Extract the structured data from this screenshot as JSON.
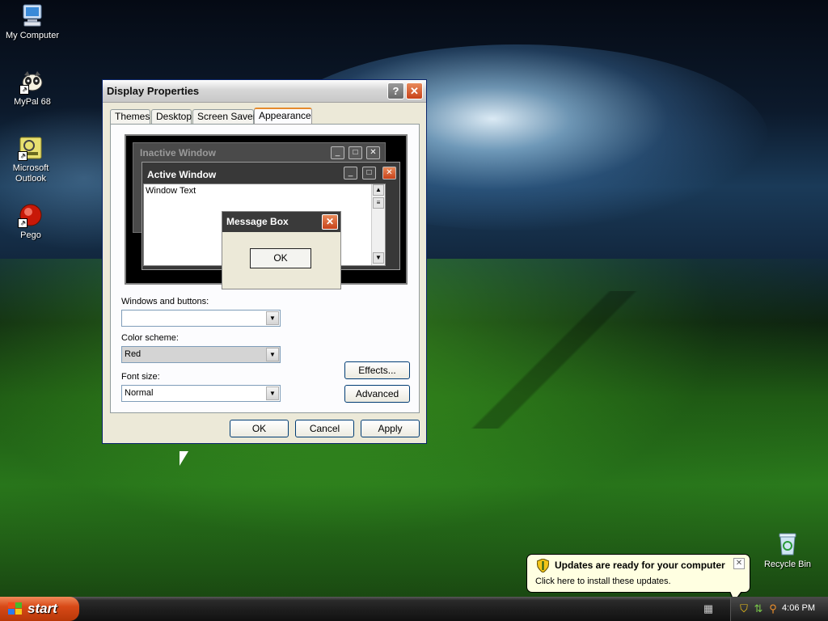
{
  "desktop": {
    "icons": [
      {
        "label": "My Computer",
        "icon": "computer-icon"
      },
      {
        "label": "MyPal 68",
        "icon": "mypal-icon"
      },
      {
        "label": "Microsoft Outlook",
        "icon": "outlook-icon"
      },
      {
        "label": "Pego",
        "icon": "pego-icon"
      },
      {
        "label": "Recycle Bin",
        "icon": "recycle-bin-icon"
      }
    ]
  },
  "dialog": {
    "title": "Display Properties",
    "help_glyph": "?",
    "close_glyph": "✕",
    "tabs": [
      "Themes",
      "Desktop",
      "Screen Saver",
      "Appearance"
    ],
    "active_tab": "Appearance",
    "preview": {
      "inactive_title": "Inactive Window",
      "active_title": "Active Window",
      "window_text": "Window Text",
      "message_title": "Message Box",
      "message_ok": "OK"
    },
    "windows_buttons_label": "Windows and buttons:",
    "windows_buttons_value": "",
    "color_scheme_label": "Color scheme:",
    "color_scheme_value": "Red",
    "font_size_label": "Font size:",
    "font_size_value": "Normal",
    "effects_label": "Effects...",
    "advanced_label": "Advanced",
    "ok_label": "OK",
    "cancel_label": "Cancel",
    "apply_label": "Apply"
  },
  "taskbar": {
    "start_label": "start",
    "clock": "4:06 PM"
  },
  "balloon": {
    "title": "Updates are ready for your computer",
    "text": "Click here to install these updates."
  },
  "colors": {
    "start_button": "#d84a18",
    "tab_highlight": "#e68b2c",
    "close_button": "#c8421a",
    "balloon_bg": "#ffffe1"
  }
}
